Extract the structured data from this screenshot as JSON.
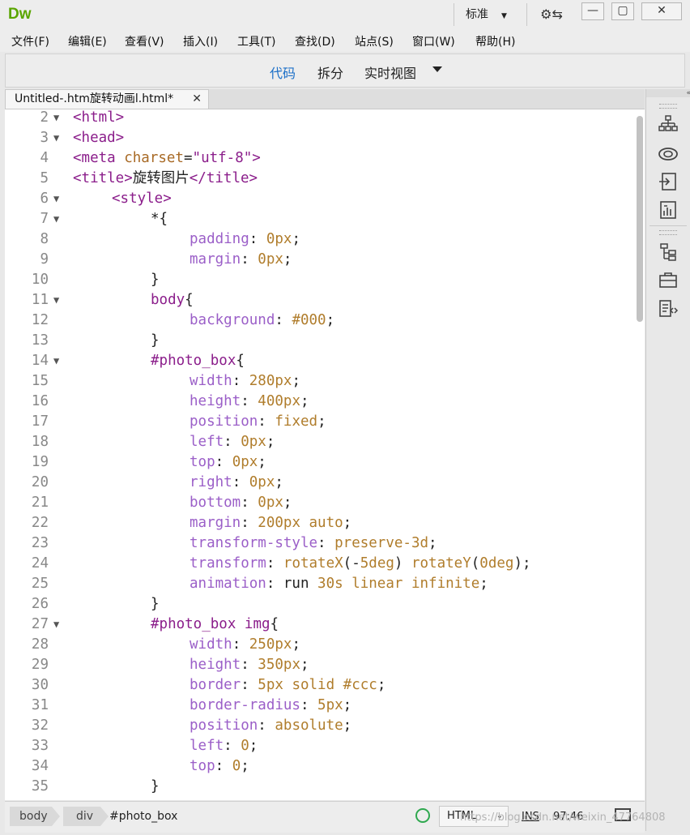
{
  "app": {
    "logo": "Dw",
    "workspace": "标准",
    "sync_icon": "sync-settings-icon"
  },
  "window_buttons": {
    "minimize": "—",
    "maximize": "▢",
    "close": "✕"
  },
  "menu": [
    "文件(F)",
    "编辑(E)",
    "查看(V)",
    "插入(I)",
    "工具(T)",
    "查找(D)",
    "站点(S)",
    "窗口(W)",
    "帮助(H)"
  ],
  "view_tabs": {
    "code": "代码",
    "split": "拆分",
    "live": "实时视图",
    "active": "代码"
  },
  "document_tab": {
    "name": "Untitled-.htm旋转动画l.html*",
    "close": "✕"
  },
  "code_lines": [
    {
      "n": "2",
      "fold": true,
      "indent": 0,
      "tokens": [
        [
          "tag",
          "<html>"
        ]
      ]
    },
    {
      "n": "3",
      "fold": true,
      "indent": 0,
      "tokens": [
        [
          "tag",
          "<head>"
        ]
      ]
    },
    {
      "n": "4",
      "fold": false,
      "indent": 0,
      "tokens": [
        [
          "tag",
          "<meta "
        ],
        [
          "attr",
          "charset"
        ],
        [
          "plain",
          "="
        ],
        [
          "str",
          "\"utf-8\""
        ],
        [
          "tag",
          ">"
        ]
      ]
    },
    {
      "n": "5",
      "fold": false,
      "indent": 0,
      "tokens": [
        [
          "tag",
          "<title>"
        ],
        [
          "plain",
          "旋转图片"
        ],
        [
          "tag",
          "</title>"
        ]
      ]
    },
    {
      "n": "6",
      "fold": true,
      "indent": 4,
      "tokens": [
        [
          "tag",
          "<style>"
        ]
      ]
    },
    {
      "n": "7",
      "fold": true,
      "indent": 8,
      "tokens": [
        [
          "plain",
          "*{"
        ]
      ]
    },
    {
      "n": "8",
      "fold": false,
      "indent": 12,
      "tokens": [
        [
          "prop",
          "padding"
        ],
        [
          "plain",
          ": "
        ],
        [
          "val",
          "0px"
        ],
        [
          "plain",
          ";"
        ]
      ]
    },
    {
      "n": "9",
      "fold": false,
      "indent": 12,
      "tokens": [
        [
          "prop",
          "margin"
        ],
        [
          "plain",
          ": "
        ],
        [
          "val",
          "0px"
        ],
        [
          "plain",
          ";"
        ]
      ]
    },
    {
      "n": "10",
      "fold": false,
      "indent": 8,
      "tokens": [
        [
          "plain",
          "}"
        ]
      ]
    },
    {
      "n": "11",
      "fold": true,
      "indent": 8,
      "tokens": [
        [
          "tag",
          "body"
        ],
        [
          "plain",
          "{"
        ]
      ]
    },
    {
      "n": "12",
      "fold": false,
      "indent": 12,
      "tokens": [
        [
          "prop",
          "background"
        ],
        [
          "plain",
          ": "
        ],
        [
          "val",
          "#000"
        ],
        [
          "plain",
          ";"
        ]
      ]
    },
    {
      "n": "13",
      "fold": false,
      "indent": 8,
      "tokens": [
        [
          "plain",
          "}"
        ]
      ]
    },
    {
      "n": "14",
      "fold": true,
      "indent": 8,
      "tokens": [
        [
          "tag",
          "#photo_box"
        ],
        [
          "plain",
          "{"
        ]
      ]
    },
    {
      "n": "15",
      "fold": false,
      "indent": 12,
      "tokens": [
        [
          "prop",
          "width"
        ],
        [
          "plain",
          ": "
        ],
        [
          "val",
          "280px"
        ],
        [
          "plain",
          ";"
        ]
      ]
    },
    {
      "n": "16",
      "fold": false,
      "indent": 12,
      "tokens": [
        [
          "prop",
          "height"
        ],
        [
          "plain",
          ": "
        ],
        [
          "val",
          "400px"
        ],
        [
          "plain",
          ";"
        ]
      ]
    },
    {
      "n": "17",
      "fold": false,
      "indent": 12,
      "tokens": [
        [
          "prop",
          "position"
        ],
        [
          "plain",
          ": "
        ],
        [
          "val",
          "fixed"
        ],
        [
          "plain",
          ";"
        ]
      ]
    },
    {
      "n": "18",
      "fold": false,
      "indent": 12,
      "tokens": [
        [
          "prop",
          "left"
        ],
        [
          "plain",
          ": "
        ],
        [
          "val",
          "0px"
        ],
        [
          "plain",
          ";"
        ]
      ]
    },
    {
      "n": "19",
      "fold": false,
      "indent": 12,
      "tokens": [
        [
          "prop",
          "top"
        ],
        [
          "plain",
          ": "
        ],
        [
          "val",
          "0px"
        ],
        [
          "plain",
          ";"
        ]
      ]
    },
    {
      "n": "20",
      "fold": false,
      "indent": 12,
      "tokens": [
        [
          "prop",
          "right"
        ],
        [
          "plain",
          ": "
        ],
        [
          "val",
          "0px"
        ],
        [
          "plain",
          ";"
        ]
      ]
    },
    {
      "n": "21",
      "fold": false,
      "indent": 12,
      "tokens": [
        [
          "prop",
          "bottom"
        ],
        [
          "plain",
          ": "
        ],
        [
          "val",
          "0px"
        ],
        [
          "plain",
          ";"
        ]
      ]
    },
    {
      "n": "22",
      "fold": false,
      "indent": 12,
      "tokens": [
        [
          "prop",
          "margin"
        ],
        [
          "plain",
          ": "
        ],
        [
          "val",
          "200px auto"
        ],
        [
          "plain",
          ";"
        ]
      ]
    },
    {
      "n": "23",
      "fold": false,
      "indent": 12,
      "tokens": [
        [
          "prop",
          "transform-style"
        ],
        [
          "plain",
          ": "
        ],
        [
          "val",
          "preserve-3d"
        ],
        [
          "plain",
          ";"
        ]
      ]
    },
    {
      "n": "24",
      "fold": false,
      "indent": 12,
      "tokens": [
        [
          "prop",
          "transform"
        ],
        [
          "plain",
          ": "
        ],
        [
          "val",
          "rotateX"
        ],
        [
          "plain",
          "(-"
        ],
        [
          "val",
          "5deg"
        ],
        [
          "plain",
          ") "
        ],
        [
          "val",
          "rotateY"
        ],
        [
          "plain",
          "("
        ],
        [
          "val",
          "0deg"
        ],
        [
          "plain",
          ");"
        ]
      ]
    },
    {
      "n": "25",
      "fold": false,
      "indent": 12,
      "tokens": [
        [
          "prop",
          "animation"
        ],
        [
          "plain",
          ": run "
        ],
        [
          "val",
          "30s"
        ],
        [
          "plain",
          " "
        ],
        [
          "val",
          "linear"
        ],
        [
          "plain",
          " "
        ],
        [
          "val",
          "infinite"
        ],
        [
          "plain",
          ";"
        ]
      ]
    },
    {
      "n": "26",
      "fold": false,
      "indent": 8,
      "tokens": [
        [
          "plain",
          "}"
        ]
      ]
    },
    {
      "n": "27",
      "fold": true,
      "indent": 8,
      "tokens": [
        [
          "tag",
          "#photo_box"
        ],
        [
          "plain",
          " "
        ],
        [
          "tag",
          "img"
        ],
        [
          "plain",
          "{"
        ]
      ]
    },
    {
      "n": "28",
      "fold": false,
      "indent": 12,
      "tokens": [
        [
          "prop",
          "width"
        ],
        [
          "plain",
          ": "
        ],
        [
          "val",
          "250px"
        ],
        [
          "plain",
          ";"
        ]
      ]
    },
    {
      "n": "29",
      "fold": false,
      "indent": 12,
      "tokens": [
        [
          "prop",
          "height"
        ],
        [
          "plain",
          ": "
        ],
        [
          "val",
          "350px"
        ],
        [
          "plain",
          ";"
        ]
      ]
    },
    {
      "n": "30",
      "fold": false,
      "indent": 12,
      "tokens": [
        [
          "prop",
          "border"
        ],
        [
          "plain",
          ": "
        ],
        [
          "val",
          "5px solid #ccc"
        ],
        [
          "plain",
          ";"
        ]
      ]
    },
    {
      "n": "31",
      "fold": false,
      "indent": 12,
      "tokens": [
        [
          "prop",
          "border-radius"
        ],
        [
          "plain",
          ": "
        ],
        [
          "val",
          "5px"
        ],
        [
          "plain",
          ";"
        ]
      ]
    },
    {
      "n": "32",
      "fold": false,
      "indent": 12,
      "tokens": [
        [
          "prop",
          "position"
        ],
        [
          "plain",
          ": "
        ],
        [
          "val",
          "absolute"
        ],
        [
          "plain",
          ";"
        ]
      ]
    },
    {
      "n": "33",
      "fold": false,
      "indent": 12,
      "tokens": [
        [
          "prop",
          "left"
        ],
        [
          "plain",
          ": "
        ],
        [
          "val",
          "0"
        ],
        [
          "plain",
          ";"
        ]
      ]
    },
    {
      "n": "34",
      "fold": false,
      "indent": 12,
      "tokens": [
        [
          "prop",
          "top"
        ],
        [
          "plain",
          ": "
        ],
        [
          "val",
          "0"
        ],
        [
          "plain",
          ";"
        ]
      ]
    },
    {
      "n": "35",
      "fold": false,
      "indent": 8,
      "tokens": [
        [
          "plain",
          "}"
        ]
      ]
    }
  ],
  "right_panel_icons": [
    "site-map-icon",
    "creative-cloud-icon",
    "insert-icon",
    "css-designer-icon",
    "dom-tree-icon",
    "assets-icon",
    "snippets-icon"
  ],
  "status": {
    "breadcrumbs": [
      "body",
      "div",
      "#photo_box"
    ],
    "language": "HTML",
    "insert_mode": "INS",
    "cursor_position": "97:46"
  },
  "watermark": "https://blog.csdn.net/weixin_47764808",
  "colors": {
    "tag": "#8b1e8b",
    "attr": "#a86a26",
    "prop": "#9b5fc8",
    "value": "#b07d2c",
    "active_view": "#1b6fc8",
    "check": "#2fa84f"
  }
}
